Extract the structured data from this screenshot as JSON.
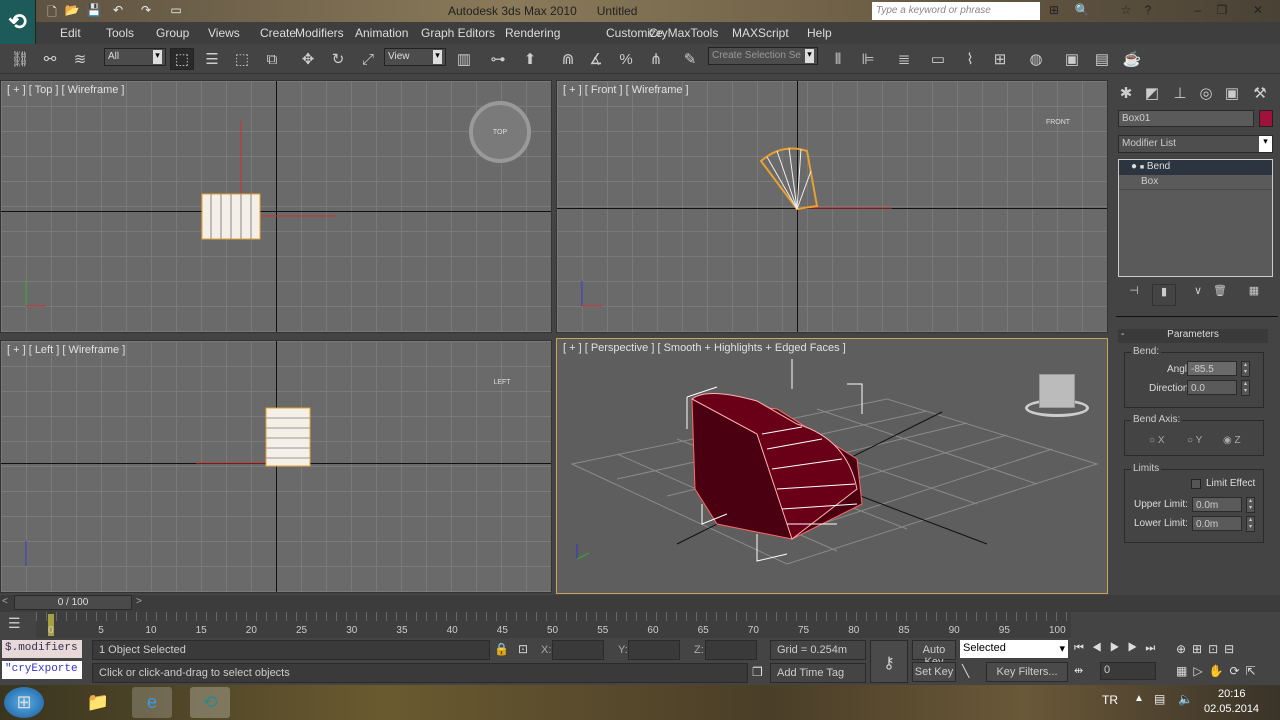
{
  "app": {
    "title": "Autodesk 3ds Max  2010",
    "document": "Untitled",
    "search_placeholder": "Type a keyword or phrase"
  },
  "menu": [
    "Edit",
    "Tools",
    "Group",
    "Views",
    "Create",
    "Modifiers",
    "Animation",
    "Graph Editors",
    "Rendering",
    "Customize",
    "CryMaxTools",
    "MAXScript",
    "Help"
  ],
  "toolbar": {
    "selection_filter": "All",
    "reference_coord": "View",
    "named_selection": "Create Selection Se",
    "snap_label": "3"
  },
  "viewports": {
    "top": "[ + ] [ Top ] [ Wireframe ]",
    "front": "[ + ] [ Front ] [ Wireframe ]",
    "left": "[ + ] [ Left ] [ Wireframe ]",
    "perspective": "[ + ] [ Perspective ] [ Smooth + Highlights + Edged Faces ]",
    "viewcube": {
      "top": "TOP",
      "front": "FRONT",
      "left": "LEFT"
    }
  },
  "command_panel": {
    "object_name": "Box01",
    "object_color": "#a0123c",
    "modifier_list": "Modifier List",
    "stack": [
      "Bend",
      "Box"
    ],
    "rollout": "Parameters",
    "bend_group": "Bend:",
    "angle_label": "Angle:",
    "angle": "-85.5",
    "direction_label": "Direction:",
    "direction": "0.0",
    "axis_group": "Bend Axis:",
    "axes": [
      "X",
      "Y",
      "Z"
    ],
    "selected_axis": "Z",
    "limits_group": "Limits",
    "limit_effect": "Limit Effect",
    "upper_label": "Upper Limit:",
    "upper": "0.0m",
    "lower_label": "Lower Limit:",
    "lower": "0.0m"
  },
  "timeline": {
    "frame": "0 / 100",
    "ticks": [
      "0",
      "5",
      "10",
      "15",
      "20",
      "25",
      "30",
      "35",
      "40",
      "45",
      "50",
      "55",
      "60",
      "65",
      "70",
      "75",
      "80",
      "85",
      "90",
      "95",
      "100"
    ]
  },
  "status": {
    "maxscript1": "$.modifiers",
    "maxscript2": "\"cryExporte",
    "selected": "1 Object Selected",
    "prompt": "Click or click-and-drag to select objects",
    "x_label": "X:",
    "y_label": "Y:",
    "z_label": "Z:",
    "grid": "Grid = 0.254m",
    "add_time_tag": "Add Time Tag",
    "auto_key": "Auto Key",
    "set_key": "Set Key",
    "key_mode": "Selected",
    "key_filters": "Key Filters...",
    "current_frame": "0"
  },
  "taskbar": {
    "lang": "TR",
    "time": "20:16",
    "date": "02.05.2014"
  }
}
